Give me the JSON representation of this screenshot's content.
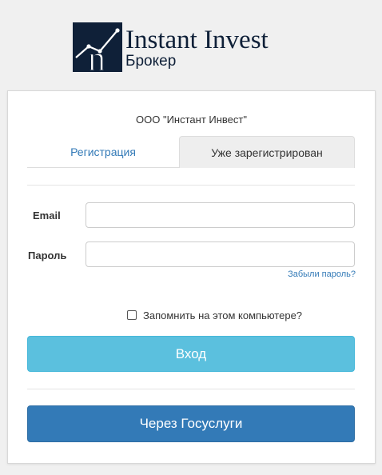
{
  "logo": {
    "title": "Instant Invest",
    "subtitle": "Брокер",
    "icon": "instant-invest-logo-mark",
    "color": "#0f2038"
  },
  "form": {
    "company": "ООО \"Инстант Инвест\"",
    "tabs": [
      {
        "label": "Регистрация",
        "active": false
      },
      {
        "label": "Уже зарегистрирован",
        "active": true
      }
    ],
    "email": {
      "label": "Email",
      "value": "",
      "placeholder": ""
    },
    "password": {
      "label": "Пароль",
      "value": "",
      "placeholder": ""
    },
    "forgot_label": "Забыли пароль?",
    "remember": {
      "label": "Запомнить на этом компьютере?",
      "checked": false
    },
    "login_button": "Вход",
    "gosuslugi_button": "Через Госуслуги"
  },
  "colors": {
    "link": "#337ab7",
    "login_button": "#5bc0de",
    "gosuslugi_button": "#337ab7"
  }
}
